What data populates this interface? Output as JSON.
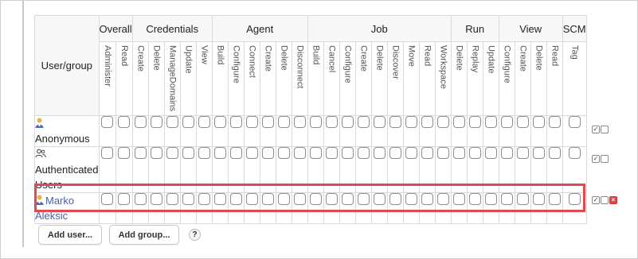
{
  "table": {
    "usergroup_header": "User/group",
    "groups": [
      {
        "label": "Overall",
        "span": 2
      },
      {
        "label": "Credentials",
        "span": 5
      },
      {
        "label": "Agent",
        "span": 6
      },
      {
        "label": "Job",
        "span": 9
      },
      {
        "label": "Run",
        "span": 3
      },
      {
        "label": "View",
        "span": 4
      },
      {
        "label": "SCM",
        "span": 1
      }
    ],
    "permissions": [
      "Administer",
      "Read",
      "Create",
      "Delete",
      "ManageDomains",
      "Update",
      "View",
      "Build",
      "Configure",
      "Connect",
      "Create",
      "Delete",
      "Disconnect",
      "Build",
      "Cancel",
      "Configure",
      "Create",
      "Delete",
      "Discover",
      "Move",
      "Read",
      "Workspace",
      "Delete",
      "Replay",
      "Update",
      "Configure",
      "Create",
      "Delete",
      "Read",
      "Tag"
    ],
    "rows": [
      {
        "name": "Anonymous",
        "type": "user",
        "checked": []
      },
      {
        "name": "Authenticated Users",
        "type": "group",
        "checked": []
      },
      {
        "name": "Marko Aleksic",
        "type": "user",
        "checked": []
      }
    ]
  },
  "row_actions": {
    "select_all": "✓",
    "unselect_all": "",
    "delete": "×"
  },
  "buttons": {
    "add_user": "Add user...",
    "add_group": "Add group...",
    "help": "?"
  },
  "colors": {
    "highlight": "#e24850",
    "link": "#4a5fa8",
    "delete": "#e04848"
  }
}
